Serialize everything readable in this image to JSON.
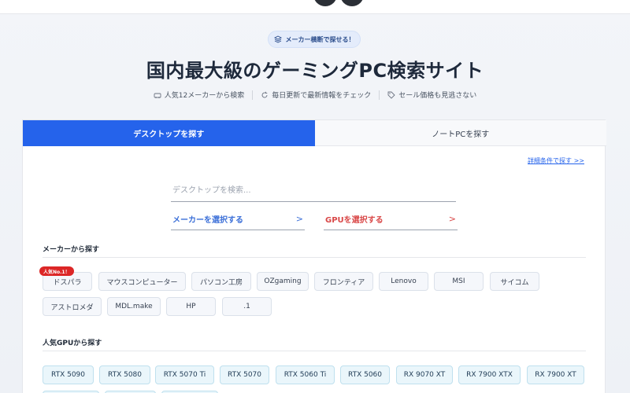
{
  "hero": {
    "pill_label": "メーカー横断で探せる！",
    "title": "国内最大級のゲーミングPC検索サイト",
    "features": [
      {
        "label": "人気12メーカーから検索"
      },
      {
        "label": "毎日更新で最新情報をチェック"
      },
      {
        "label": "セール価格も見逃さない"
      }
    ]
  },
  "tabs": {
    "desktop": "デスクトップを探す",
    "notebook": "ノートPCを探す"
  },
  "search": {
    "detail_link": "詳細条件で探す >>",
    "placeholder": "デスクトップを検索...",
    "maker_select": "メーカーを選択する",
    "gpu_select": "GPUを選択する",
    "chevron": ">"
  },
  "makers": {
    "title": "メーカーから探す",
    "badge": "人気No.1！",
    "items": [
      "ドスパラ",
      "マウスコンピューター",
      "パソコン工房",
      "OZgaming",
      "フロンティア",
      "Lenovo",
      "MSI",
      "サイコム",
      "アストロメダ",
      "MDL.make",
      "HP",
      ".1"
    ]
  },
  "gpus": {
    "title": "人気GPUから探す",
    "items": [
      "RTX 5090",
      "RTX 5080",
      "RTX 5070 Ti",
      "RTX 5070",
      "RTX 5060 Ti",
      "RTX 5060",
      "RX 9070 XT",
      "RX 7900 XTX",
      "RX 7900 XT"
    ]
  },
  "colors": {
    "accent": "#2563eb",
    "maker_select": "#3b6fd8",
    "gpu_select": "#d94848",
    "badge": "#dc2626"
  }
}
